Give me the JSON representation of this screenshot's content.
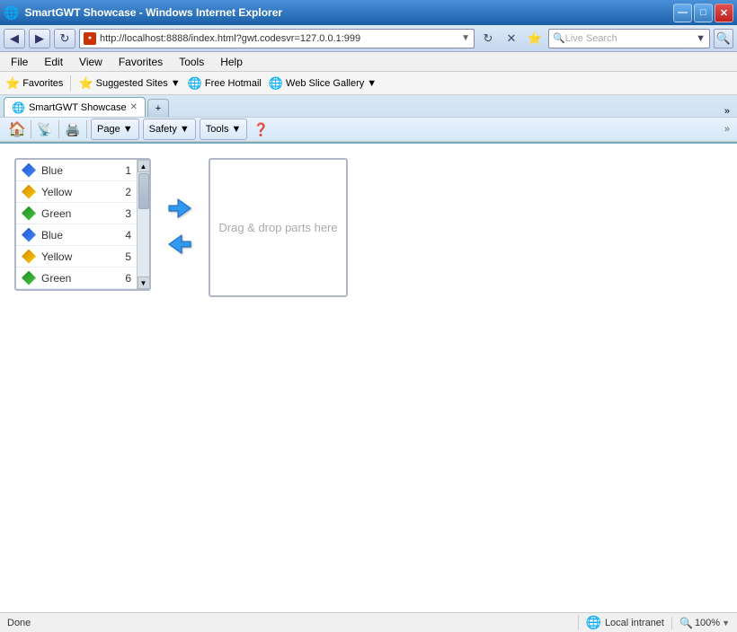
{
  "title_bar": {
    "title": "SmartGWT Showcase - Windows Internet Explorer",
    "icon": "IE",
    "minimize_label": "—",
    "maximize_label": "□",
    "close_label": "✕"
  },
  "nav_bar": {
    "back_label": "◀",
    "forward_label": "▶",
    "refresh_label": "↻",
    "stop_label": "✕",
    "address": "http://localhost:8888/index.html?gwt.codesvr=127.0.0.1:999",
    "go_label": "▼",
    "search_placeholder": "Live Search",
    "search_btn_label": "🔍"
  },
  "menu_bar": {
    "items": [
      {
        "label": "File"
      },
      {
        "label": "Edit"
      },
      {
        "label": "View"
      },
      {
        "label": "Favorites"
      },
      {
        "label": "Tools"
      },
      {
        "label": "Help"
      }
    ]
  },
  "fav_bar": {
    "favorites_label": "Favorites",
    "items": [
      {
        "label": "Suggested Sites ▼",
        "icon": "⭐"
      },
      {
        "label": "Free Hotmail",
        "icon": "🌐"
      },
      {
        "label": "Web Slice Gallery ▼",
        "icon": "🌐"
      }
    ]
  },
  "tab_bar": {
    "tabs": [
      {
        "label": "SmartGWT Showcase",
        "active": true
      }
    ]
  },
  "toolbar": {
    "page_label": "Page ▼",
    "safety_label": "Safety ▼",
    "tools_label": "Tools ▼",
    "help_label": "❓"
  },
  "list": {
    "items": [
      {
        "color": "Blue",
        "num": "1",
        "icon_type": "blue"
      },
      {
        "color": "Yellow",
        "num": "2",
        "icon_type": "yellow"
      },
      {
        "color": "Green",
        "num": "3",
        "icon_type": "green"
      },
      {
        "color": "Blue",
        "num": "4",
        "icon_type": "blue"
      },
      {
        "color": "Yellow",
        "num": "5",
        "icon_type": "yellow"
      },
      {
        "color": "Green",
        "num": "6",
        "icon_type": "green"
      }
    ]
  },
  "drop_panel": {
    "placeholder": "Drag & drop parts here"
  },
  "status_bar": {
    "text": "Done",
    "zone": "Local intranet",
    "zoom": "100%"
  }
}
